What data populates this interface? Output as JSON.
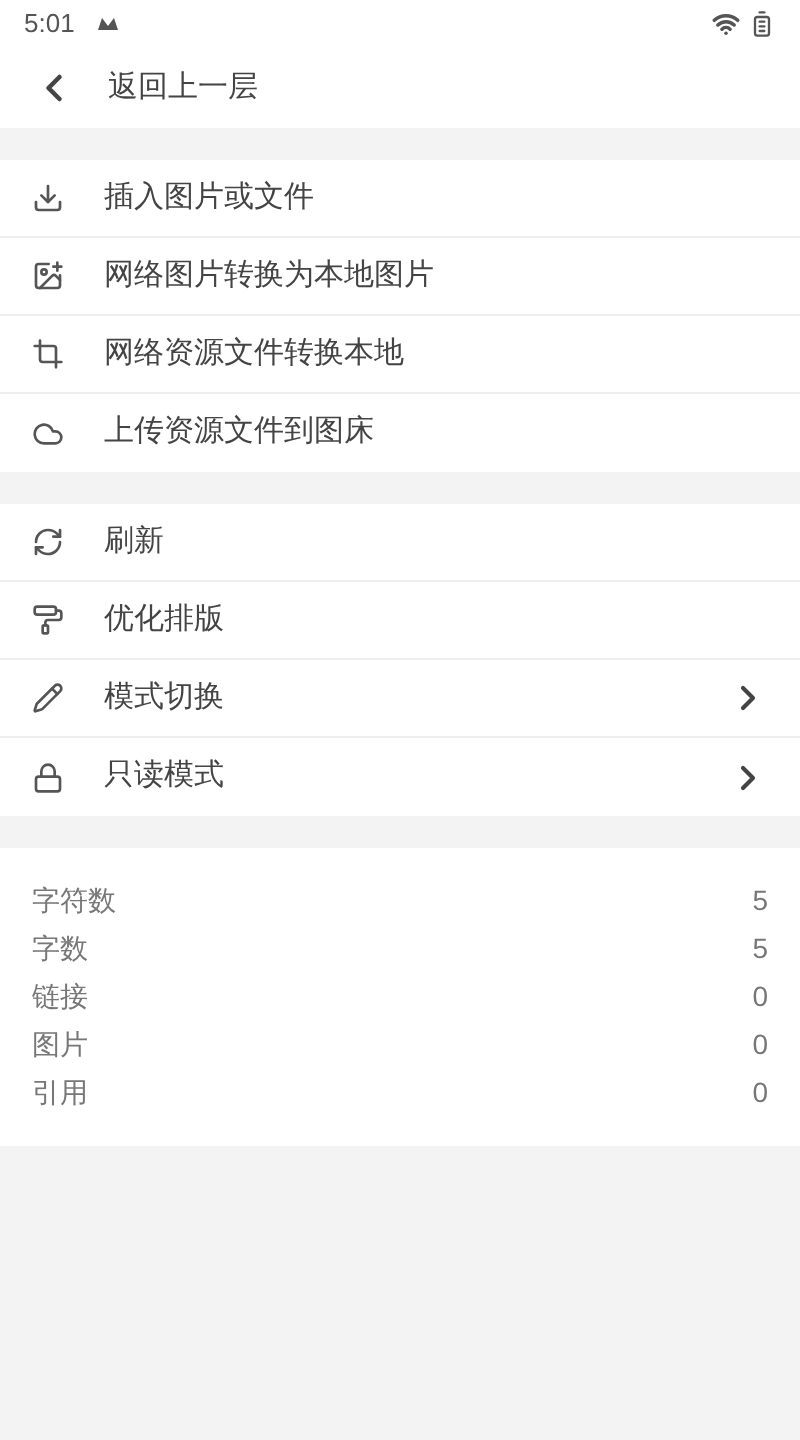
{
  "status_bar": {
    "time": "5:01"
  },
  "header": {
    "title": "返回上一层"
  },
  "menu_groups": [
    {
      "items": [
        {
          "label": "插入图片或文件",
          "submenu": false
        },
        {
          "label": "网络图片转换为本地图片",
          "submenu": false
        },
        {
          "label": "网络资源文件转换本地",
          "submenu": false
        },
        {
          "label": "上传资源文件到图床",
          "submenu": false
        }
      ]
    },
    {
      "items": [
        {
          "label": "刷新",
          "submenu": false
        },
        {
          "label": "优化排版",
          "submenu": false
        },
        {
          "label": "模式切换",
          "submenu": true
        },
        {
          "label": "只读模式",
          "submenu": true
        }
      ]
    }
  ],
  "stats": [
    {
      "label": "字符数",
      "value": "5"
    },
    {
      "label": "字数",
      "value": "5"
    },
    {
      "label": "链接",
      "value": "0"
    },
    {
      "label": "图片",
      "value": "0"
    },
    {
      "label": "引用",
      "value": "0"
    }
  ]
}
